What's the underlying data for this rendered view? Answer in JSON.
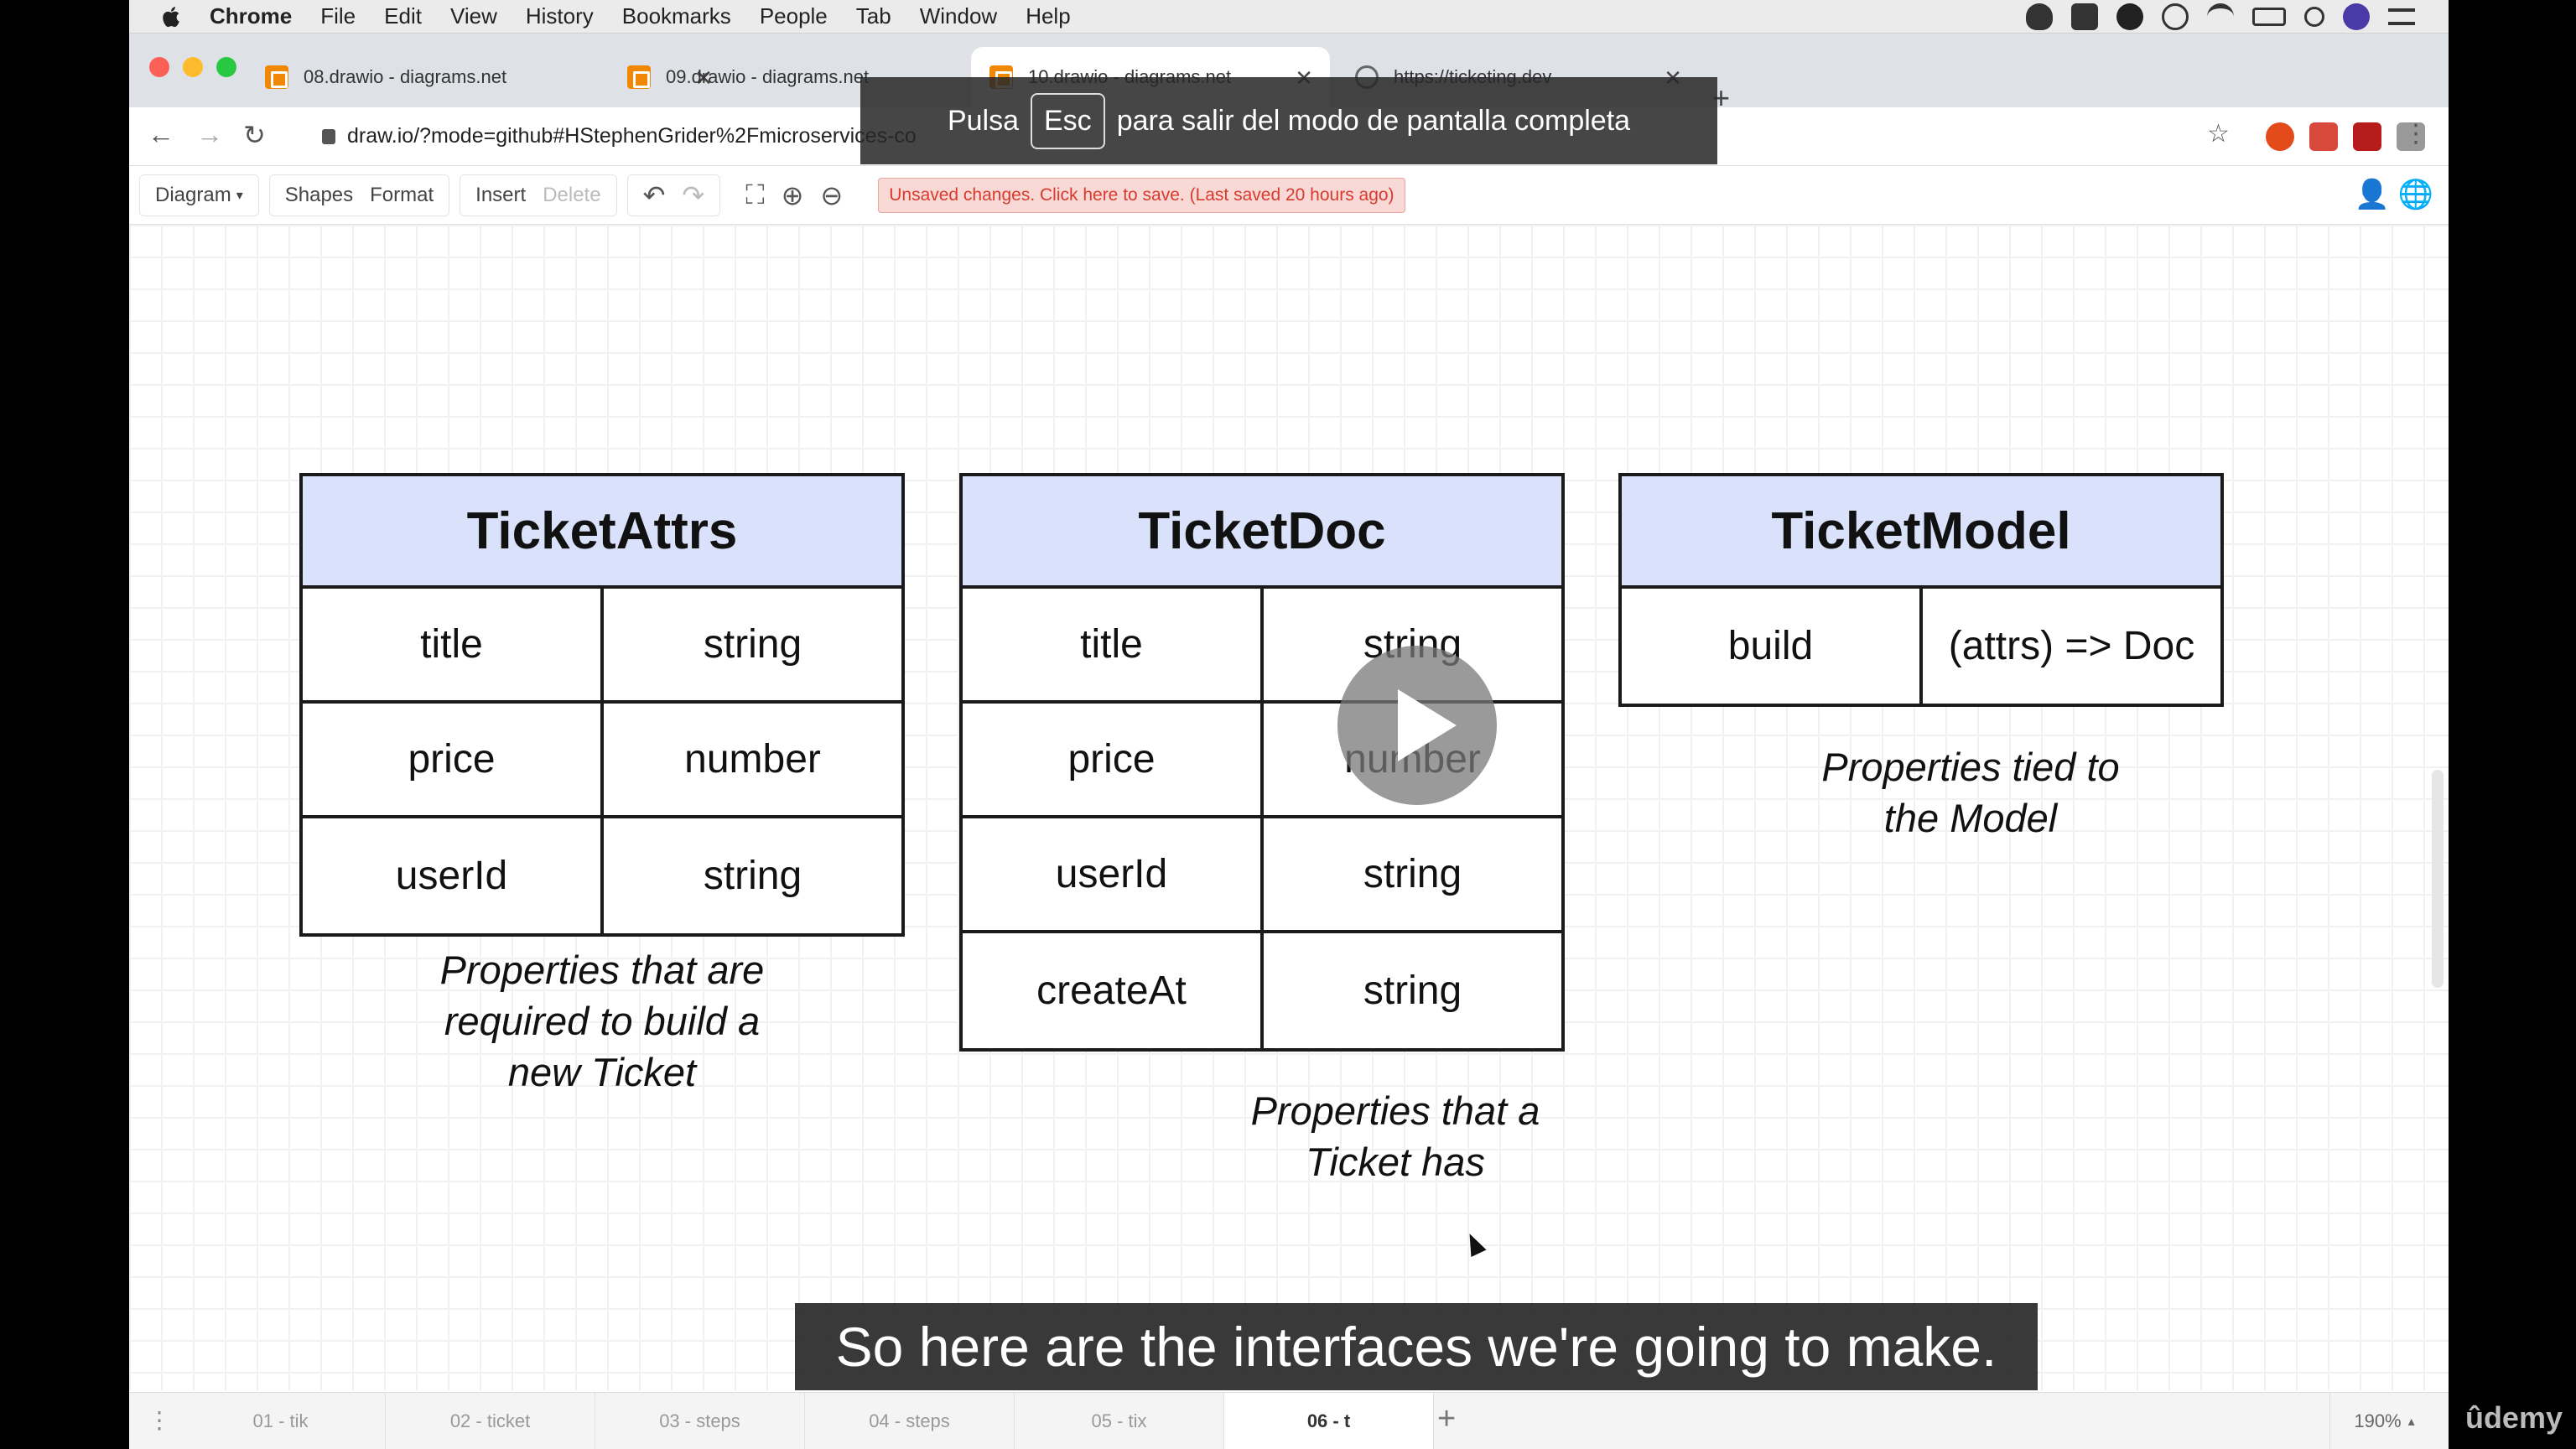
{
  "menubar": {
    "items": [
      "Chrome",
      "File",
      "Edit",
      "View",
      "History",
      "Bookmarks",
      "People",
      "Tab",
      "Window",
      "Help"
    ]
  },
  "tabs": [
    {
      "label": "08.drawio - diagrams.net"
    },
    {
      "label": "09.drawio - diagrams.net"
    },
    {
      "label": "10.drawio - diagrams.net"
    },
    {
      "label": "https://ticketing.dev"
    }
  ],
  "addressbar": {
    "url": "draw.io/?mode=github#HStephenGrider%2Fmicroservices-co"
  },
  "fullscreen_notice": {
    "before": "Pulsa",
    "key": "Esc",
    "after": "para salir del modo de pantalla completa"
  },
  "toolbar": {
    "diagram": "Diagram",
    "shapes": "Shapes",
    "format": "Format",
    "insert": "Insert",
    "delete": "Delete",
    "unsaved": "Unsaved changes. Click here to save. (Last saved 20 hours ago)"
  },
  "diagram": {
    "entities": [
      {
        "title": "TicketAttrs",
        "rows": [
          [
            "title",
            "string"
          ],
          [
            "price",
            "number"
          ],
          [
            "userId",
            "string"
          ]
        ],
        "caption": [
          "Properties that are",
          "required to build a",
          "new Ticket"
        ]
      },
      {
        "title": "TicketDoc",
        "rows": [
          [
            "title",
            "string"
          ],
          [
            "price",
            "number"
          ],
          [
            "userId",
            "string"
          ],
          [
            "createAt",
            "string"
          ]
        ],
        "caption": [
          "Properties that a",
          "Ticket has"
        ]
      },
      {
        "title": "TicketModel",
        "rows": [
          [
            "build",
            "(attrs) => Doc"
          ]
        ],
        "caption": [
          "Properties tied to",
          "the Model"
        ]
      }
    ]
  },
  "subtitle": "So here are the interfaces we're going to make.",
  "pages": [
    "01 - tik",
    "02 - ticket",
    "03 - steps",
    "04 - steps",
    "05 - tix",
    "06 - t"
  ],
  "zoom": "190%",
  "watermark": "ûdemy"
}
